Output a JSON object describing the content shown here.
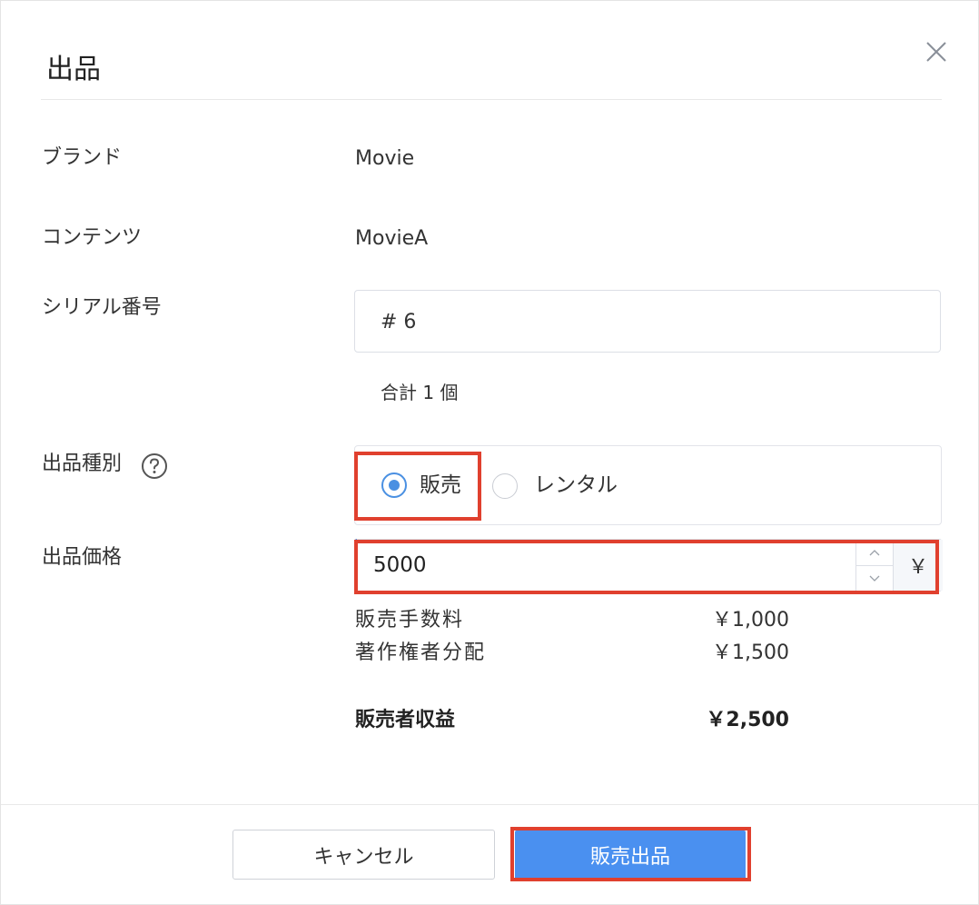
{
  "dialog": {
    "title": "出品",
    "close_icon": "close-icon"
  },
  "fields": {
    "brand_label": "ブランド",
    "brand_value": "Movie",
    "content_label": "コンテンツ",
    "content_value": "MovieA",
    "serial_label": "シリアル番号",
    "serial_value": "# 6",
    "total_text": "合計 1 個",
    "listing_type_label": "出品種別",
    "listing_type_help_icon": "question-circle-icon",
    "listing_type_options": [
      {
        "label": "販売",
        "selected": true
      },
      {
        "label": "レンタル",
        "selected": false
      }
    ],
    "price_label": "出品価格",
    "price_value": "5000",
    "currency_symbol": "￥"
  },
  "breakdown": [
    {
      "label": "販売手数料",
      "amount": "￥1,000",
      "bold": false
    },
    {
      "label": "著作権者分配",
      "amount": "￥1,500",
      "bold": false
    },
    {
      "label": "販売者収益",
      "amount": "￥2,500",
      "bold": true
    }
  ],
  "actions": {
    "cancel_label": "キャンセル",
    "submit_label": "販売出品"
  },
  "colors": {
    "accent": "#4a90f0",
    "highlight": "#e0402e"
  }
}
